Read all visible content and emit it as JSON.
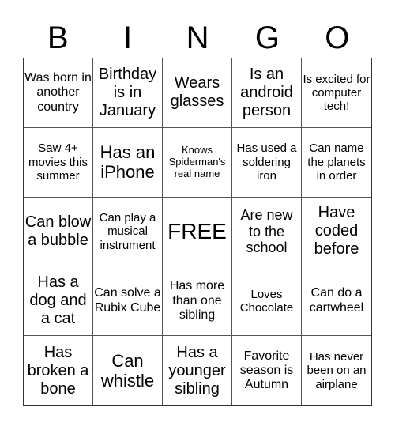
{
  "header": {
    "letters": [
      "B",
      "I",
      "N",
      "G",
      "O"
    ]
  },
  "cells": [
    "Was born in another country",
    "Birthday is in January",
    "Wears glasses",
    "Is an android person",
    "Is excited for computer tech!",
    "Saw 4+ movies this summer",
    "Has an iPhone",
    "Knows Spiderman's real name",
    "Has used a soldering iron",
    "Can name the planets in order",
    "Can blow a bubble",
    "Can play a musical instrument",
    "FREE",
    "Are new to the school",
    "Have coded before",
    "Has a dog and a cat",
    "Can solve a Rubix Cube",
    "Has more than one sibling",
    "Loves Chocolate",
    "Can do a cartwheel",
    "Has broken a bone",
    "Can whistle",
    "Has a younger sibling",
    "Favorite season is Autumn",
    "Has never been on an airplane"
  ]
}
